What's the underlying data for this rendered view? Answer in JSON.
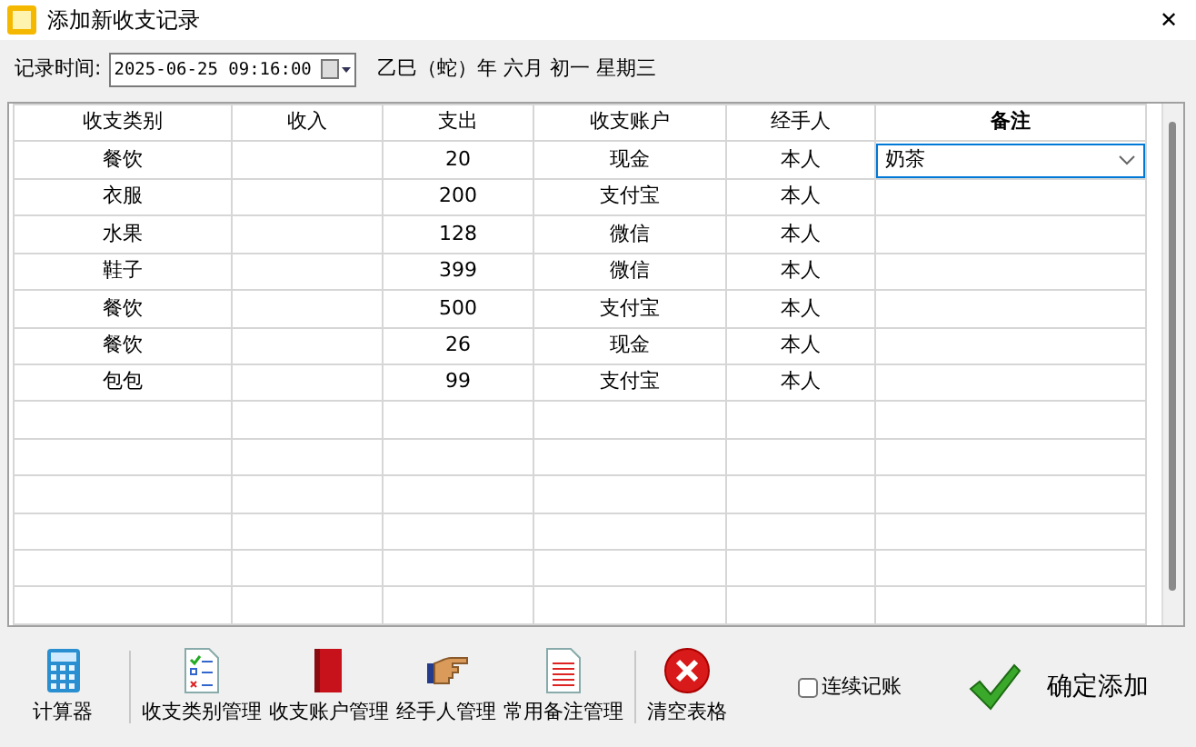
{
  "window": {
    "title": "添加新收支记录",
    "close": "✕"
  },
  "record_time": {
    "label": "记录时间:",
    "value": "2025-06-25 09:16:00",
    "lunar": "乙巳（蛇）年 六月 初一 星期三"
  },
  "table": {
    "columns": [
      {
        "label": "收支类别",
        "selected": false
      },
      {
        "label": "收入",
        "selected": false
      },
      {
        "label": "支出",
        "selected": false
      },
      {
        "label": "收支账户",
        "selected": false
      },
      {
        "label": "经手人",
        "selected": false
      },
      {
        "label": "备注",
        "selected": true
      }
    ],
    "rows": [
      {
        "cells": [
          "餐饮",
          "",
          "20",
          "现金",
          "本人",
          "奶茶"
        ],
        "editing": true
      },
      {
        "cells": [
          "衣服",
          "",
          "200",
          "支付宝",
          "本人",
          ""
        ],
        "editing": false
      },
      {
        "cells": [
          "水果",
          "",
          "128",
          "微信",
          "本人",
          ""
        ],
        "editing": false
      },
      {
        "cells": [
          "鞋子",
          "",
          "399",
          "微信",
          "本人",
          ""
        ],
        "editing": false
      },
      {
        "cells": [
          "餐饮",
          "",
          "500",
          "支付宝",
          "本人",
          ""
        ],
        "editing": false
      },
      {
        "cells": [
          "餐饮",
          "",
          "26",
          "现金",
          "本人",
          ""
        ],
        "editing": false
      },
      {
        "cells": [
          "包包",
          "",
          "99",
          "支付宝",
          "本人",
          ""
        ],
        "editing": false
      }
    ]
  },
  "toolbar": [
    {
      "label": "计算器",
      "kind": "calculator"
    },
    {
      "label": "收支类别管理",
      "kind": "checklist"
    },
    {
      "label": "收支账户管理",
      "kind": "book"
    },
    {
      "label": "经手人管理",
      "kind": "hand"
    },
    {
      "label": "常用备注管理",
      "kind": "document"
    },
    {
      "label": "清空表格",
      "kind": "clear"
    }
  ],
  "continuous": {
    "label": "连续记账",
    "checked": false
  },
  "confirm": {
    "label": "确定添加"
  }
}
